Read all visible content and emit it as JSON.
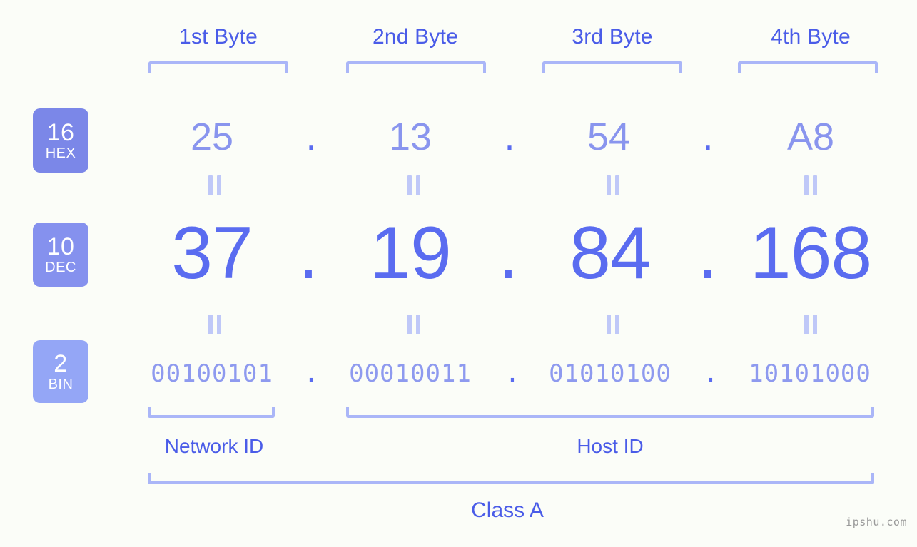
{
  "background_color": "#fbfdf8",
  "accent_color": "#5a6cf0",
  "bracket_color": "#aab6f8",
  "byte_headers": [
    {
      "label": "1st Byte"
    },
    {
      "label": "2nd Byte"
    },
    {
      "label": "3rd Byte"
    },
    {
      "label": "4th Byte"
    }
  ],
  "bases": [
    {
      "number": "16",
      "name": "HEX",
      "color": "#7b87e8"
    },
    {
      "number": "10",
      "name": "DEC",
      "color": "#8591ee"
    },
    {
      "number": "2",
      "name": "BIN",
      "color": "#94a6f6"
    }
  ],
  "rows": {
    "hex": {
      "base_number": "16",
      "base_name": "HEX",
      "values": [
        "25",
        "13",
        "54",
        "A8"
      ],
      "separator": "."
    },
    "dec": {
      "base_number": "10",
      "base_name": "DEC",
      "values": [
        "37",
        "19",
        "84",
        "168"
      ],
      "separator": "."
    },
    "bin": {
      "base_number": "2",
      "base_name": "BIN",
      "values": [
        "00100101",
        "00010011",
        "01010100",
        "10101000"
      ],
      "separator": "."
    }
  },
  "equals_marks": {
    "glyph": "||",
    "count_per_row": 4
  },
  "segments": {
    "network_id": "Network ID",
    "host_id": "Host ID",
    "class": "Class A"
  },
  "watermark": "ipshu.com"
}
